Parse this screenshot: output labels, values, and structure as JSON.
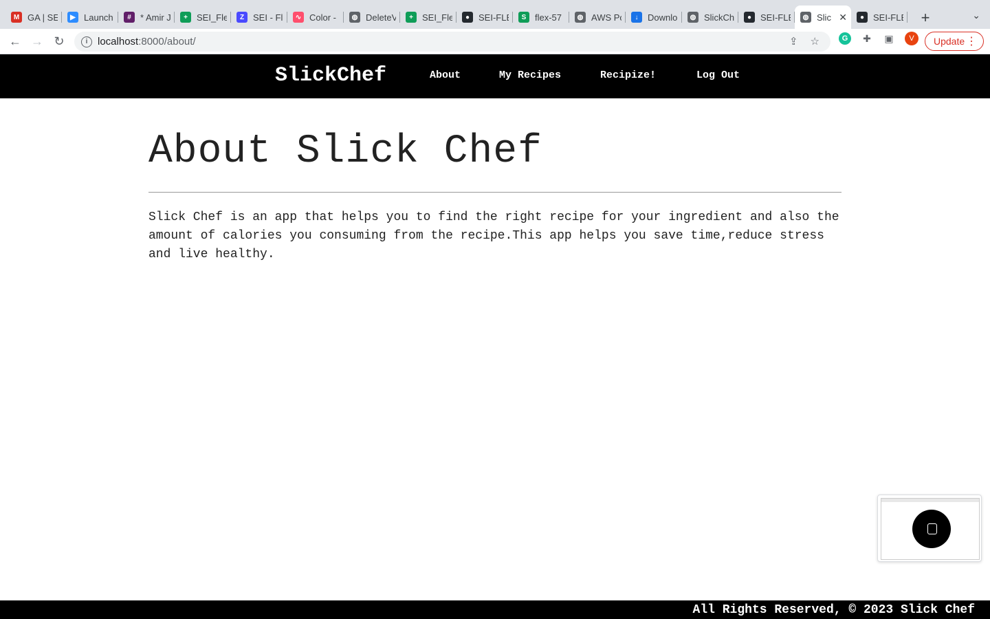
{
  "browser": {
    "tabs": [
      {
        "title": "GA | SE",
        "icon": "gmail-icon",
        "color": "#d93025",
        "glyph": "M"
      },
      {
        "title": "Launch",
        "icon": "zoom-icon",
        "color": "#2d8cff",
        "glyph": "▶"
      },
      {
        "title": "* Amir J",
        "icon": "slack-icon",
        "color": "#611f69",
        "glyph": "#"
      },
      {
        "title": "SEI_Fle",
        "icon": "sheets-icon",
        "color": "#0f9d58",
        "glyph": "+"
      },
      {
        "title": "SEI - Fl",
        "icon": "zapier-icon",
        "color": "#4a4aff",
        "glyph": "Z"
      },
      {
        "title": "Color -",
        "icon": "coolors-icon",
        "color": "#ff4f6d",
        "glyph": "∿"
      },
      {
        "title": "DeleteV",
        "icon": "globe-icon",
        "color": "#5f6368",
        "glyph": "◍"
      },
      {
        "title": "SEI_Fle",
        "icon": "sheets-icon",
        "color": "#0f9d58",
        "glyph": "+"
      },
      {
        "title": "SEI-FLE",
        "icon": "github-icon",
        "color": "#24292f",
        "glyph": "●"
      },
      {
        "title": "flex-57",
        "icon": "sheets-icon",
        "color": "#0f9d58",
        "glyph": "S"
      },
      {
        "title": "AWS Po",
        "icon": "globe-icon",
        "color": "#5f6368",
        "glyph": "◍"
      },
      {
        "title": "Downlo",
        "icon": "download-icon",
        "color": "#1a73e8",
        "glyph": "↓"
      },
      {
        "title": "SlickCh",
        "icon": "globe-icon",
        "color": "#5f6368",
        "glyph": "◍"
      },
      {
        "title": "SEI-FLE",
        "icon": "github-icon",
        "color": "#24292f",
        "glyph": "●"
      },
      {
        "title": "Slic",
        "icon": "globe-icon",
        "color": "#5f6368",
        "glyph": "◍",
        "active": true
      },
      {
        "title": "SEI-FLE",
        "icon": "github-icon",
        "color": "#24292f",
        "glyph": "●"
      }
    ],
    "url_host": "localhost",
    "url_rest": ":8000/about/",
    "update_label": "Update",
    "profile_initial": "V"
  },
  "site": {
    "brand": "SlickChef",
    "nav": [
      {
        "label": "About"
      },
      {
        "label": "My Recipes"
      },
      {
        "label": "Recipize!"
      },
      {
        "label": "Log Out"
      }
    ]
  },
  "about": {
    "title": "About Slick Chef",
    "body": "Slick Chef is an app that helps you to find the right recipe for your ingredient and also the amount of calories you consuming from the recipe.This app helps you save time,reduce stress and live healthy."
  },
  "footer": {
    "text": "All Rights Reserved, © 2023 Slick Chef"
  }
}
